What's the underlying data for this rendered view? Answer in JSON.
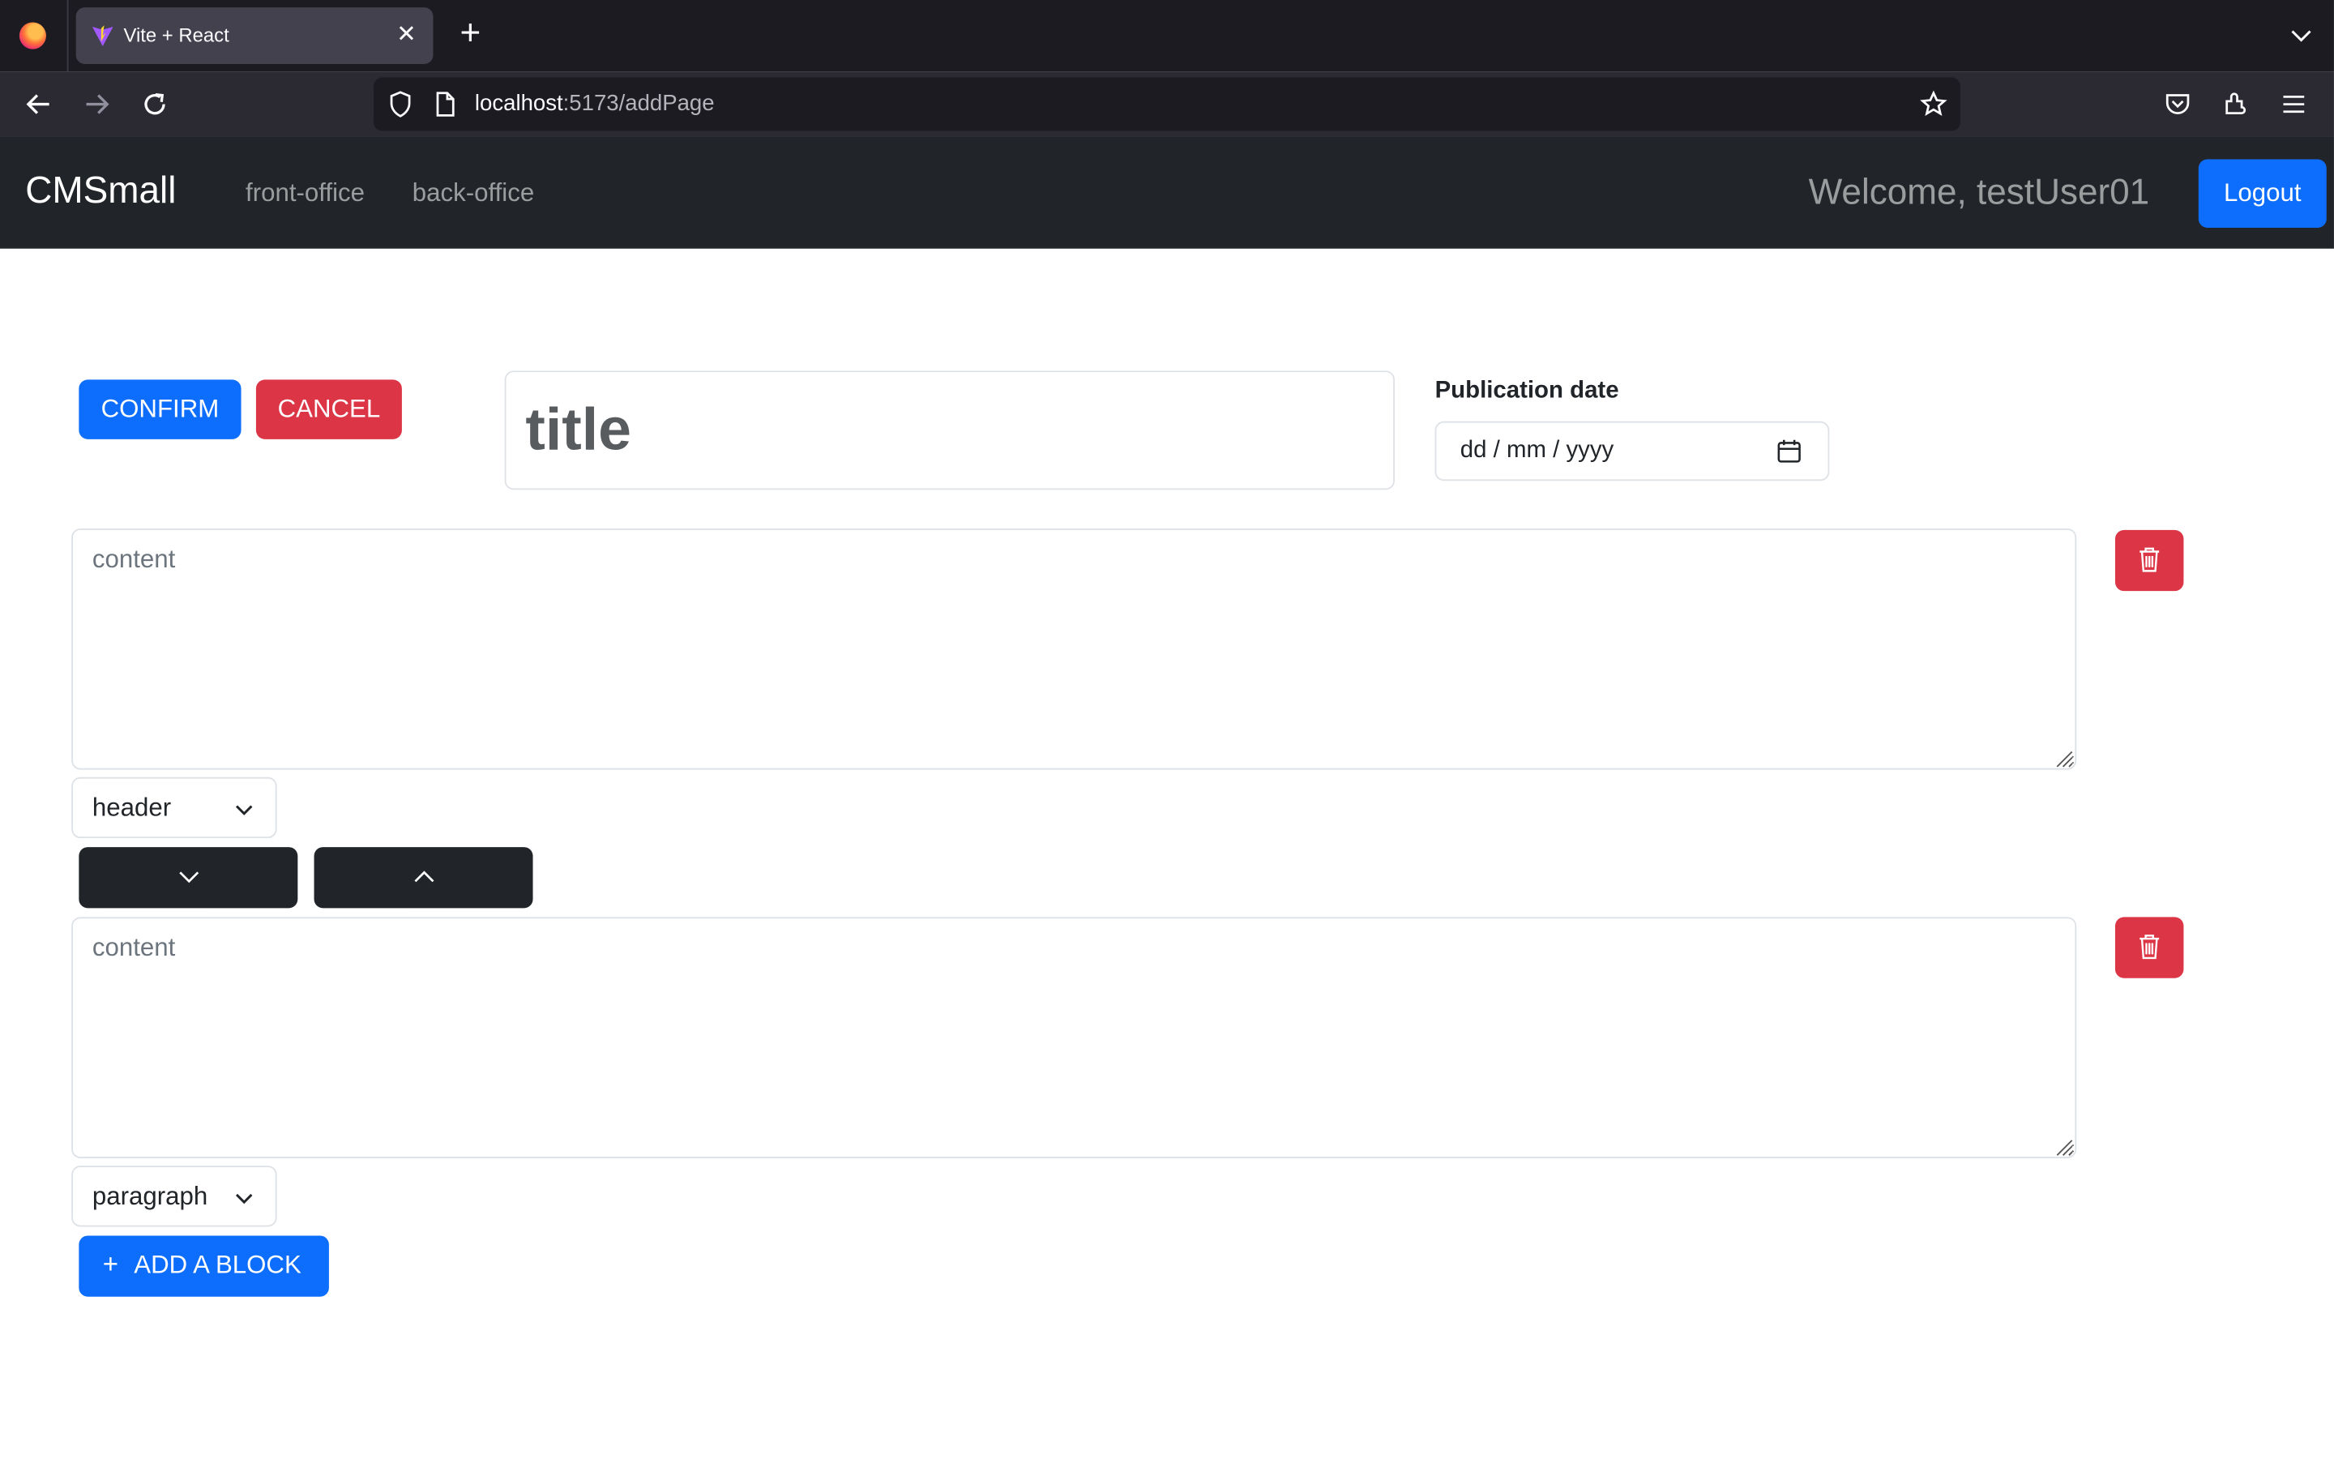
{
  "browser": {
    "tab_title": "Vite + React",
    "url_host": "localhost",
    "url_path": ":5173/addPage"
  },
  "navbar": {
    "brand": "CMSmall",
    "links": [
      "front-office",
      "back-office"
    ],
    "welcome": "Welcome, testUser01",
    "logout_label": "Logout"
  },
  "form": {
    "confirm_label": "CONFIRM",
    "cancel_label": "CANCEL",
    "title_placeholder": "title",
    "publication_label": "Publication date",
    "date_placeholder": "dd / mm / yyyy"
  },
  "blocks": [
    {
      "placeholder": "content",
      "type": "header"
    },
    {
      "placeholder": "content",
      "type": "paragraph"
    }
  ],
  "add_block_label": "ADD A BLOCK",
  "add_block_icon": "+",
  "colors": {
    "primary": "#0d6efd",
    "danger": "#dc3545",
    "dark": "#212529"
  }
}
